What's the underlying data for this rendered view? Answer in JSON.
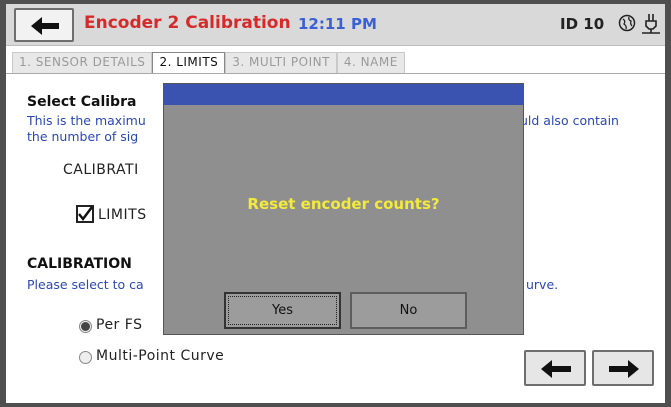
{
  "header": {
    "title": "Encoder 2 Calibration",
    "time": "12:11 PM",
    "device_id": "ID 10",
    "icons": [
      "back-arrow-icon",
      "globe-icon",
      "plug-icon"
    ]
  },
  "tabs": [
    {
      "label": "1. SENSOR DETAILS",
      "active": false
    },
    {
      "label": "2. LIMITS",
      "active": true
    },
    {
      "label": "3. MULTI POINT",
      "active": false
    },
    {
      "label": "4. NAME",
      "active": false
    }
  ],
  "main": {
    "select_title": "Select Calibra",
    "select_desc_line1_left": "This is the maximu",
    "select_desc_line1_right": "uld also contain",
    "select_desc_line2": "the number of sig",
    "calibration_label": "CALIBRATI",
    "limits_label": "LIMITS",
    "limits_checked": true,
    "cal_section_title": "CALIBRATION",
    "cal_desc_left": "Please select to ca",
    "cal_desc_right": "urve.",
    "radio_per_fs": "Per FS",
    "radio_multi_point": "Multi-Point Curve",
    "selected_radio": "per_fs"
  },
  "dialog": {
    "message": "Reset encoder counts?",
    "yes_label": "Yes",
    "no_label": "No"
  },
  "colors": {
    "title": "#d62a2a",
    "time": "#3a5fd6",
    "description": "#2b47b5",
    "dialog_message": "#f3ea3c",
    "dialog_bar": "#3a53b0"
  }
}
